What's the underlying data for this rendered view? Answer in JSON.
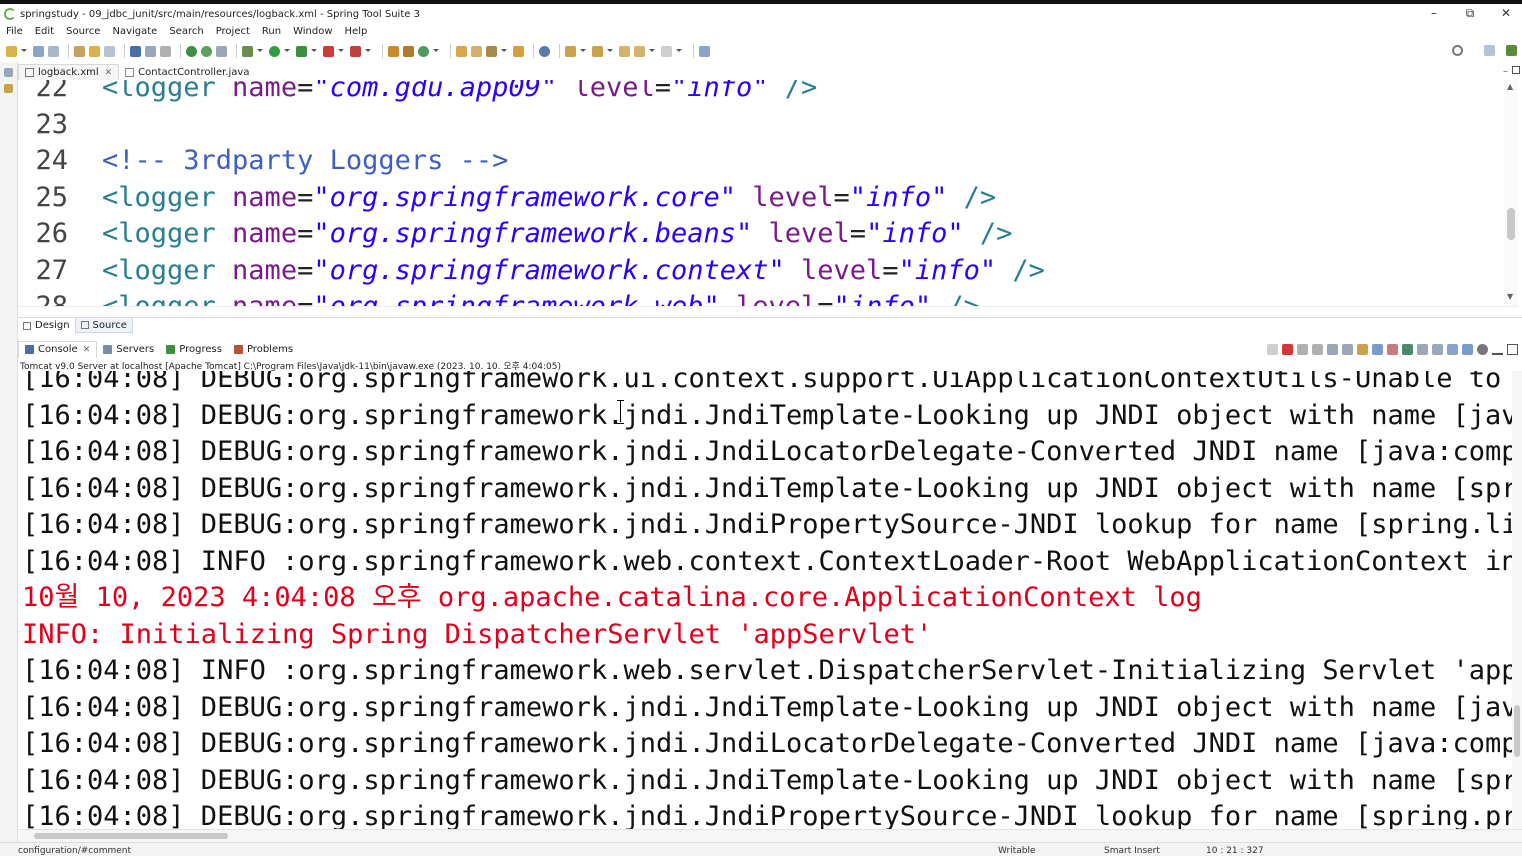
{
  "window": {
    "title": "springstudy - 09_jdbc_junit/src/main/resources/logback.xml - Spring Tool Suite 3",
    "minimize": "–",
    "restore": "⧉",
    "close": "✕"
  },
  "menu": [
    "File",
    "Edit",
    "Source",
    "Navigate",
    "Search",
    "Project",
    "Run",
    "Window",
    "Help"
  ],
  "editor_tabs": [
    {
      "label": "logback.xml",
      "active": true,
      "close": "✕"
    },
    {
      "label": "ContactController.java",
      "active": false
    }
  ],
  "editor": {
    "lines": [
      {
        "num": "22",
        "parts": [
          [
            "tag",
            "<logger "
          ],
          [
            "attr",
            "name"
          ],
          [
            "eq",
            "="
          ],
          [
            "val",
            "\"com.gdu.app09\""
          ],
          [
            "eq",
            " "
          ],
          [
            "attr",
            "level"
          ],
          [
            "eq",
            "="
          ],
          [
            "val",
            "\"info\""
          ],
          [
            "tag",
            " />"
          ]
        ]
      },
      {
        "num": "23",
        "parts": []
      },
      {
        "num": "24",
        "parts": [
          [
            "comment",
            "<!-- 3rdparty Loggers -->"
          ]
        ]
      },
      {
        "num": "25",
        "parts": [
          [
            "tag",
            "<logger "
          ],
          [
            "attr",
            "name"
          ],
          [
            "eq",
            "="
          ],
          [
            "val",
            "\"org.springframework.core\""
          ],
          [
            "eq",
            " "
          ],
          [
            "attr",
            "level"
          ],
          [
            "eq",
            "="
          ],
          [
            "val",
            "\"info\""
          ],
          [
            "tag",
            " />"
          ]
        ]
      },
      {
        "num": "26",
        "parts": [
          [
            "tag",
            "<logger "
          ],
          [
            "attr",
            "name"
          ],
          [
            "eq",
            "="
          ],
          [
            "val",
            "\"org.springframework.beans\""
          ],
          [
            "eq",
            " "
          ],
          [
            "attr",
            "level"
          ],
          [
            "eq",
            "="
          ],
          [
            "val",
            "\"info\""
          ],
          [
            "tag",
            " />"
          ]
        ]
      },
      {
        "num": "27",
        "parts": [
          [
            "tag",
            "<logger "
          ],
          [
            "attr",
            "name"
          ],
          [
            "eq",
            "="
          ],
          [
            "val",
            "\"org.springframework.context\""
          ],
          [
            "eq",
            " "
          ],
          [
            "attr",
            "level"
          ],
          [
            "eq",
            "="
          ],
          [
            "val",
            "\"info\""
          ],
          [
            "tag",
            " />"
          ]
        ]
      },
      {
        "num": "28",
        "parts": [
          [
            "tag",
            "<logger "
          ],
          [
            "attr",
            "name"
          ],
          [
            "eq",
            "="
          ],
          [
            "val",
            "\"org.springframework.web\""
          ],
          [
            "eq",
            " "
          ],
          [
            "attr",
            "level"
          ],
          [
            "eq",
            "="
          ],
          [
            "val",
            "\"info\""
          ],
          [
            "tag",
            " />"
          ]
        ]
      }
    ]
  },
  "bottom_tabs": [
    {
      "label": "Design",
      "active": false
    },
    {
      "label": "Source",
      "active": true
    }
  ],
  "console_tabs": [
    {
      "label": "Console",
      "active": true,
      "color": "#4a6fa5",
      "close": "✕"
    },
    {
      "label": "Servers",
      "active": false,
      "color": "#7a8ca8"
    },
    {
      "label": "Progress",
      "active": false,
      "color": "#3e8e41"
    },
    {
      "label": "Problems",
      "active": false,
      "color": "#b5523b"
    }
  ],
  "console_description": "Tomcat v9.0 Server at localhost [Apache Tomcat] C:\\Program Files\\Java\\jdk-11\\bin\\javaw.exe  (2023. 10. 10. 오후 4:04:05)",
  "console_lines": [
    {
      "text": "[16:04:08] DEBUG:org.springframework.ui.context.support.UiApplicationContextUtils-Unable to lo",
      "err": false
    },
    {
      "text": "[16:04:08] DEBUG:org.springframework.jndi.JndiTemplate-Looking up JNDI object with name [java:",
      "err": false
    },
    {
      "text": "[16:04:08] DEBUG:org.springframework.jndi.JndiLocatorDelegate-Converted JNDI name [java:comp/e",
      "err": false
    },
    {
      "text": "[16:04:08] DEBUG:org.springframework.jndi.JndiTemplate-Looking up JNDI object with name [sprin",
      "err": false
    },
    {
      "text": "[16:04:08] DEBUG:org.springframework.jndi.JndiPropertySource-JNDI lookup for name [spring.live",
      "err": false
    },
    {
      "text": "[16:04:08] INFO :org.springframework.web.context.ContextLoader-Root WebApplicationContext init",
      "err": false
    },
    {
      "text": "10월 10, 2023 4:04:08 오후 org.apache.catalina.core.ApplicationContext log",
      "err": true
    },
    {
      "text": "INFO: Initializing Spring DispatcherServlet 'appServlet'",
      "err": true
    },
    {
      "text": "[16:04:08] INFO :org.springframework.web.servlet.DispatcherServlet-Initializing Servlet 'appSe",
      "err": false
    },
    {
      "text": "[16:04:08] DEBUG:org.springframework.jndi.JndiTemplate-Looking up JNDI object with name [java:",
      "err": false
    },
    {
      "text": "[16:04:08] DEBUG:org.springframework.jndi.JndiLocatorDelegate-Converted JNDI name [java:comp/e",
      "err": false
    },
    {
      "text": "[16:04:08] DEBUG:org.springframework.jndi.JndiTemplate-Looking up JNDI object with name [sprin",
      "err": false
    },
    {
      "text": "[16:04:08] DEBUG:org.springframework.jndi.JndiPropertySource-JNDI lookup for name [spring.prof",
      "err": false
    }
  ],
  "status": {
    "path": "configuration/#comment",
    "writable": "Writable",
    "insert_mode": "Smart Insert",
    "position": "10 : 21 : 327"
  },
  "colors": {
    "tag": "#2a7f8f",
    "attr": "#7a1a8a",
    "value": "#2a00ff",
    "comment": "#3f5fbf",
    "stderr": "#e0001b"
  }
}
